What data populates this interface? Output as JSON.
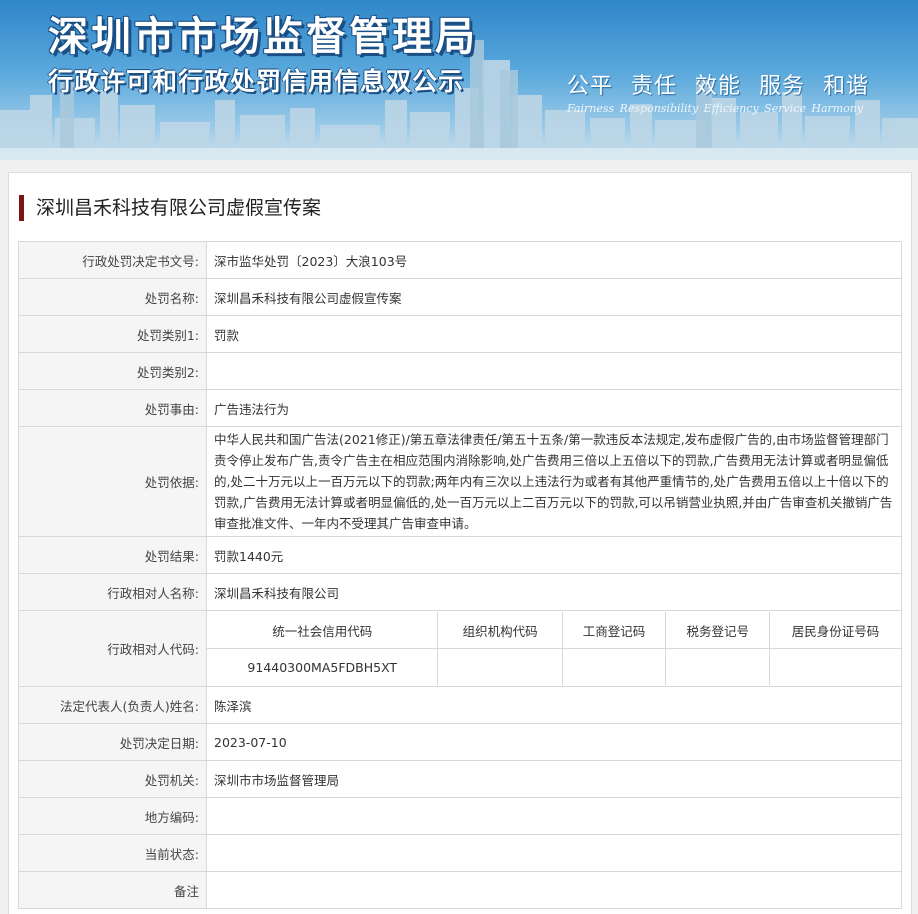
{
  "header": {
    "site_title": "深圳市市场监督管理局",
    "site_subtitle": "行政许可和行政处罚信用信息双公示",
    "slogan_cn": "公平 责任 效能 服务 和谐",
    "slogan_en": "Fairness Responsibility Efficiency Service Harmony"
  },
  "case": {
    "title": "深圳昌禾科技有限公司虚假宣传案"
  },
  "fields": {
    "decision_no": {
      "label": "行政处罚决定书文号:",
      "value": "深市监华处罚〔2023〕大浪103号"
    },
    "penalty_name": {
      "label": "处罚名称:",
      "value": "深圳昌禾科技有限公司虚假宣传案"
    },
    "category1": {
      "label": "处罚类别1:",
      "value": "罚款"
    },
    "category2": {
      "label": "处罚类别2:",
      "value": ""
    },
    "reason": {
      "label": "处罚事由:",
      "value": "广告违法行为"
    },
    "basis": {
      "label": "处罚依据:",
      "value": "中华人民共和国广告法(2021修正)/第五章法律责任/第五十五条/第一款违反本法规定,发布虚假广告的,由市场监督管理部门责令停止发布广告,责令广告主在相应范围内消除影响,处广告费用三倍以上五倍以下的罚款,广告费用无法计算或者明显偏低的,处二十万元以上一百万元以下的罚款;两年内有三次以上违法行为或者有其他严重情节的,处广告费用五倍以上十倍以下的罚款,广告费用无法计算或者明显偏低的,处一百万元以上二百万元以下的罚款,可以吊销营业执照,并由广告审查机关撤销广告审查批准文件、一年内不受理其广告审查申请。"
    },
    "result": {
      "label": "处罚结果:",
      "value": "罚款1440元"
    },
    "party_name": {
      "label": "行政相对人名称:",
      "value": "深圳昌禾科技有限公司"
    },
    "party_code": {
      "label": "行政相对人代码:",
      "headers": [
        "统一社会信用代码",
        "组织机构代码",
        "工商登记码",
        "税务登记号",
        "居民身份证号码"
      ],
      "values": [
        "91440300MA5FDBH5XT",
        "",
        "",
        "",
        ""
      ]
    },
    "legal_rep": {
      "label": "法定代表人(负责人)姓名:",
      "value": "陈泽滨"
    },
    "decision_date": {
      "label": "处罚决定日期:",
      "value": "2023-07-10"
    },
    "authority": {
      "label": "处罚机关:",
      "value": "深圳市市场监督管理局"
    },
    "region_code": {
      "label": "地方编码:",
      "value": ""
    },
    "status": {
      "label": "当前状态:",
      "value": ""
    },
    "remarks": {
      "label": "备注",
      "value": ""
    }
  }
}
